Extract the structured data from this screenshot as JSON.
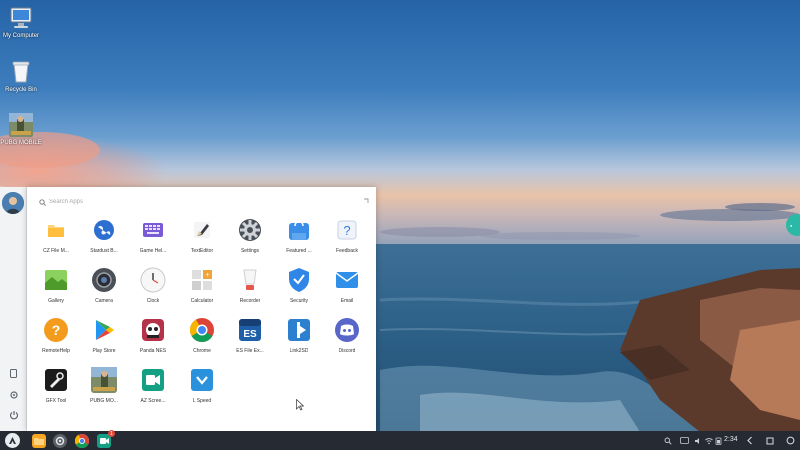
{
  "desktop": {
    "icons": [
      {
        "label": "My Computer",
        "icon": "computer-icon"
      },
      {
        "label": "Recycle Bin",
        "icon": "recycle-bin-icon"
      },
      {
        "label": "PUBG MOBILE",
        "icon": "pubg-icon"
      }
    ]
  },
  "launcher": {
    "search_placeholder": "Search Apps",
    "apps": [
      {
        "label": "CZ File M...",
        "icon": "folder-icon",
        "color": "#f6a623"
      },
      {
        "label": "Stardust B...",
        "icon": "globe-icon",
        "color": "#1f6fd1"
      },
      {
        "label": "Game Hel...",
        "icon": "keyboard-icon",
        "color": "#6a4bc4"
      },
      {
        "label": "TextEditor",
        "icon": "pen-icon",
        "color": "#e9e9e9"
      },
      {
        "label": "Settings",
        "icon": "gear-icon",
        "color": "#555b63"
      },
      {
        "label": "Featured ...",
        "icon": "store-bag-icon",
        "color": "#3b8fe6"
      },
      {
        "label": "Feedback",
        "icon": "question-icon",
        "color": "#e8eef7"
      },
      {
        "label": "Gallery",
        "icon": "gallery-icon",
        "color": "#6cbf3f"
      },
      {
        "label": "Camera",
        "icon": "camera-icon",
        "color": "#5a5e66"
      },
      {
        "label": "Clock",
        "icon": "clock-icon",
        "color": "#f2f2f2"
      },
      {
        "label": "Calculator",
        "icon": "calculator-icon",
        "color": "#e2e2e2"
      },
      {
        "label": "Recorder",
        "icon": "recorder-icon",
        "color": "#f3f3f3"
      },
      {
        "label": "Security",
        "icon": "shield-icon",
        "color": "#2f86e6"
      },
      {
        "label": "Email",
        "icon": "email-icon",
        "color": "#2f8fe9"
      },
      {
        "label": "RemoteHelp",
        "icon": "remote-help-icon",
        "color": "#f39b1d"
      },
      {
        "label": "Play Store",
        "icon": "play-store-icon",
        "color": "#ffffff"
      },
      {
        "label": "Panda NES",
        "icon": "panda-icon",
        "color": "#b5334a"
      },
      {
        "label": "Chrome",
        "icon": "chrome-icon",
        "color": "#ffffff"
      },
      {
        "label": "ES File Ex...",
        "icon": "es-file-icon",
        "color": "#1f5fa8"
      },
      {
        "label": "Link2SD",
        "icon": "link2sd-icon",
        "color": "#2d7fd0"
      },
      {
        "label": "Discord",
        "icon": "discord-icon",
        "color": "#5865c9"
      },
      {
        "label": "GFX Tool",
        "icon": "gfx-tool-icon",
        "color": "#1c1c1c"
      },
      {
        "label": "PUBG MO...",
        "icon": "pubg-icon",
        "color": "#6c7d5c"
      },
      {
        "label": "AZ Scree...",
        "icon": "az-screen-icon",
        "color": "#14a085"
      },
      {
        "label": "L Speed",
        "icon": "l-speed-icon",
        "color": "#2a91dc"
      }
    ]
  },
  "taskbar": {
    "clock": "2:34",
    "badge_count": "1",
    "pinned": [
      {
        "icon": "file-manager-icon",
        "color": "#f6a623"
      },
      {
        "icon": "settings-icon",
        "color": "#5b6068"
      },
      {
        "icon": "chrome-icon",
        "color": "#ffffff"
      },
      {
        "icon": "az-screen-icon",
        "color": "#14a085"
      }
    ]
  }
}
